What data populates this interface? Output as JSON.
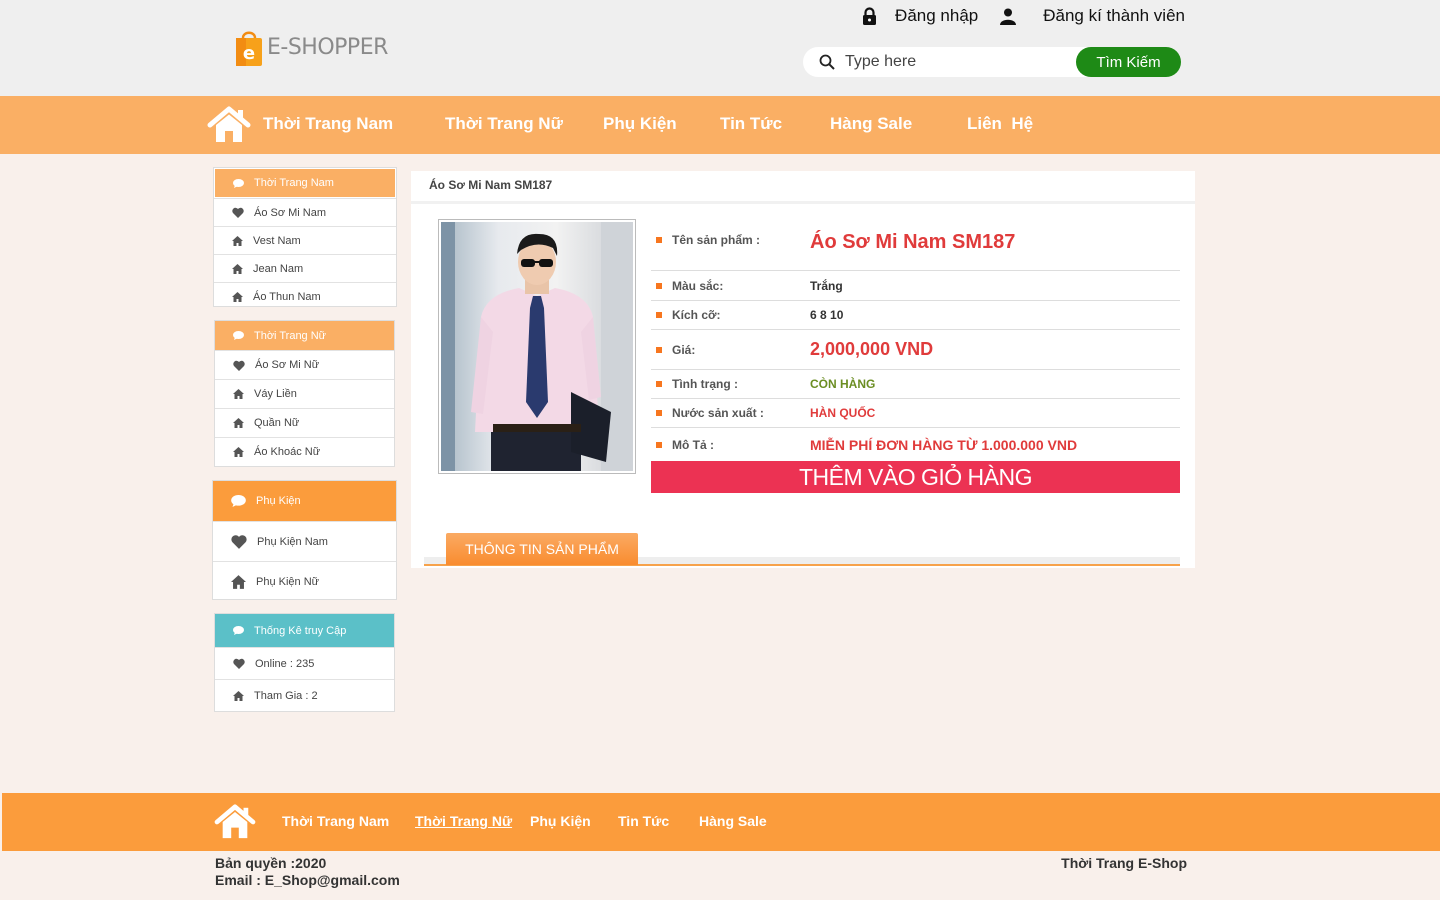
{
  "header": {
    "logo_text": "E-SHOPPER",
    "logo_letter": "e",
    "login_label": "Đăng nhập",
    "register_label": "Đăng kí thành viên",
    "search_placeholder": "Type here",
    "search_button": "Tìm Kiếm"
  },
  "nav": {
    "items": [
      "Thời Trang Nam",
      "Thời Trang Nữ",
      "Phụ Kiện",
      "Tin Tức",
      "Hàng Sale",
      "Liên  Hệ"
    ]
  },
  "sidebar": {
    "men": {
      "title": "Thời Trang Nam",
      "items": [
        "Áo Sơ Mi Nam",
        "Vest Nam",
        "Jean Nam",
        "Áo Thun Nam"
      ]
    },
    "women": {
      "title": "Thời Trang Nữ",
      "items": [
        "Áo Sơ Mi Nữ",
        "Váy Liền",
        "Quần Nữ",
        "Áo Khoác Nữ"
      ]
    },
    "accessories": {
      "title": "Phụ Kiện",
      "items": [
        "Phụ Kiện Nam",
        "Phụ Kiện Nữ"
      ]
    },
    "stats": {
      "title": "Thống Kê truy Cập",
      "items": [
        "Online : 235",
        "Tham Gia : 2"
      ]
    }
  },
  "product": {
    "breadcrumb": "Áo Sơ Mi Nam SM187",
    "name_label": "Tên sản phẩm :",
    "name": "Áo Sơ Mi Nam SM187",
    "color_label": "Màu sắc:",
    "color": "Trắng",
    "size_label": "Kích cỡ:",
    "size": "6 8 10",
    "price_label": "Giá:",
    "price": "2,000,000 VND",
    "status_label": "Tình trạng :",
    "status": "CÒN HÀNG",
    "origin_label": "Nước sản xuất :",
    "origin": "HÀN QUỐC",
    "desc_label": "Mô Tả :",
    "desc": "MIỄN PHÍ ĐƠN HÀNG TỪ 1.000.000 VND",
    "add_to_cart": "THÊM VÀO GIỎ HÀNG",
    "info_tab": "THÔNG TIN SẢN PHẨM"
  },
  "footer": {
    "nav": [
      "Thời Trang Nam",
      "Thời Trang Nữ",
      "Phụ Kiện",
      "Tin Tức",
      "Hàng Sale"
    ],
    "copyright": "Bản quyền :2020",
    "email": "Email : E_Shop@gmail.com",
    "brand": "Thời Trang E-Shop"
  },
  "colors": {
    "accent_orange": "#faaf64",
    "footer_orange": "#fb9c3c",
    "search_green": "#1e8a16",
    "cart_red": "#ec3253",
    "stats_teal": "#5bc0c8",
    "price_red": "#e03b3b",
    "status_green": "#6b8e23"
  },
  "icons": {
    "login": "lock-icon",
    "register": "user-icon",
    "search": "search-icon",
    "home": "home-icon",
    "sidebar_head": "chat-bubble-icon",
    "sidebar_row_heart": "heart-icon",
    "sidebar_row_house": "house-icon"
  }
}
